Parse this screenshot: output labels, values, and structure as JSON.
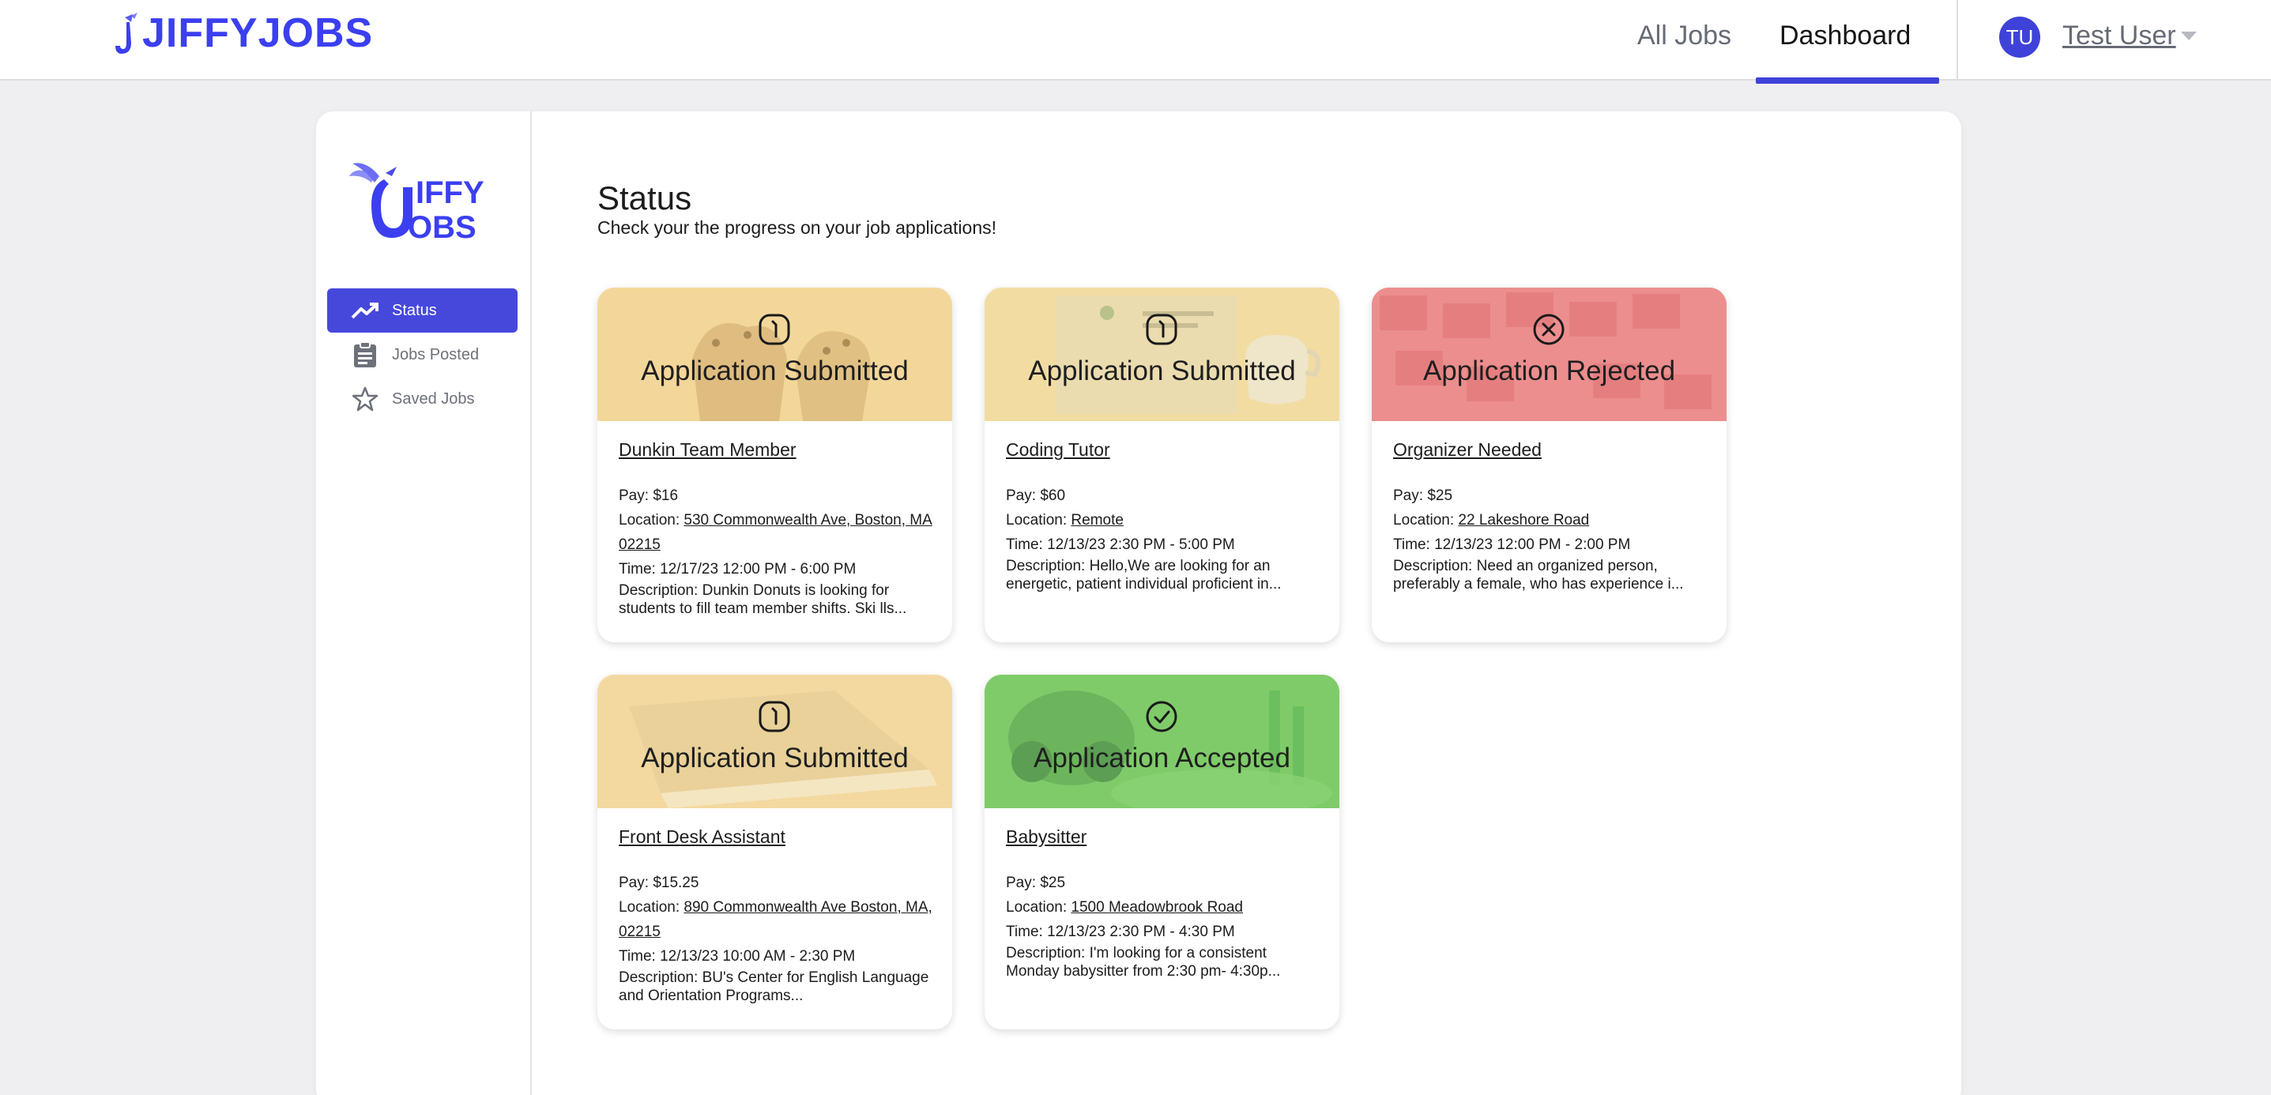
{
  "header": {
    "brand": "JIFFYJOBS",
    "nav": [
      {
        "label": "All Jobs"
      },
      {
        "label": "Dashboard"
      }
    ],
    "user": {
      "initials": "TU",
      "name": "Test User"
    }
  },
  "sidebar": {
    "logo_text_top": "IFFY",
    "logo_text_bottom": "OBS",
    "items": [
      {
        "label": "Status",
        "icon": "trending-up-icon",
        "active": true
      },
      {
        "label": "Jobs Posted",
        "icon": "clipboard-icon",
        "active": false
      },
      {
        "label": "Saved Jobs",
        "icon": "star-icon",
        "active": false
      }
    ]
  },
  "main": {
    "title": "Status",
    "subtitle": "Check your the progress on your job applications!"
  },
  "labels": {
    "pay": "Pay:",
    "location": "Location:",
    "time": "Time:",
    "description": "Description:"
  },
  "colors": {
    "accent": "#3f42d8",
    "submitted": "#f6dba0",
    "rejected": "#ee8d8d",
    "accepted": "#7ed06a"
  },
  "cards": [
    {
      "status": "Application Submitted",
      "status_icon": "clock-icon",
      "title": "Dunkin Team Member",
      "pay": "$16",
      "location": "530 Commonwealth Ave, Boston, MA 02215",
      "time": "12/17/23 12:00 PM - 6:00 PM",
      "description": "Dunkin Donuts is looking for students to fill team member shifts. Ski lls..."
    },
    {
      "status": "Application Submitted",
      "status_icon": "clock-icon",
      "title": "Coding Tutor",
      "pay": "$60",
      "location": "Remote",
      "time": "12/13/23 2:30 PM - 5:00 PM",
      "description": "Hello,We are looking for an energetic, patient individual proficient in..."
    },
    {
      "status": "Application Rejected",
      "status_icon": "x-circle-icon",
      "title": "Organizer Needed",
      "pay": "$25",
      "location": "22 Lakeshore Road",
      "time": "12/13/23 12:00 PM - 2:00 PM",
      "description": "Need an organized person, preferably a female, who has experience i..."
    },
    {
      "status": "Application Submitted",
      "status_icon": "clock-icon",
      "title": "Front Desk Assistant",
      "pay": "$15.25",
      "location": "890 Commonwealth Ave Boston, MA, 02215",
      "time": "12/13/23 10:00 AM - 2:30 PM",
      "description": "BU's Center for English Language and Orientation Programs..."
    },
    {
      "status": "Application Accepted",
      "status_icon": "check-circle-icon",
      "title": "Babysitter",
      "pay": "$25",
      "location": "1500 Meadowbrook Road",
      "time": "12/13/23 2:30 PM - 4:30 PM",
      "description": "I'm looking for a consistent Monday babysitter from 2:30 pm- 4:30p..."
    }
  ]
}
